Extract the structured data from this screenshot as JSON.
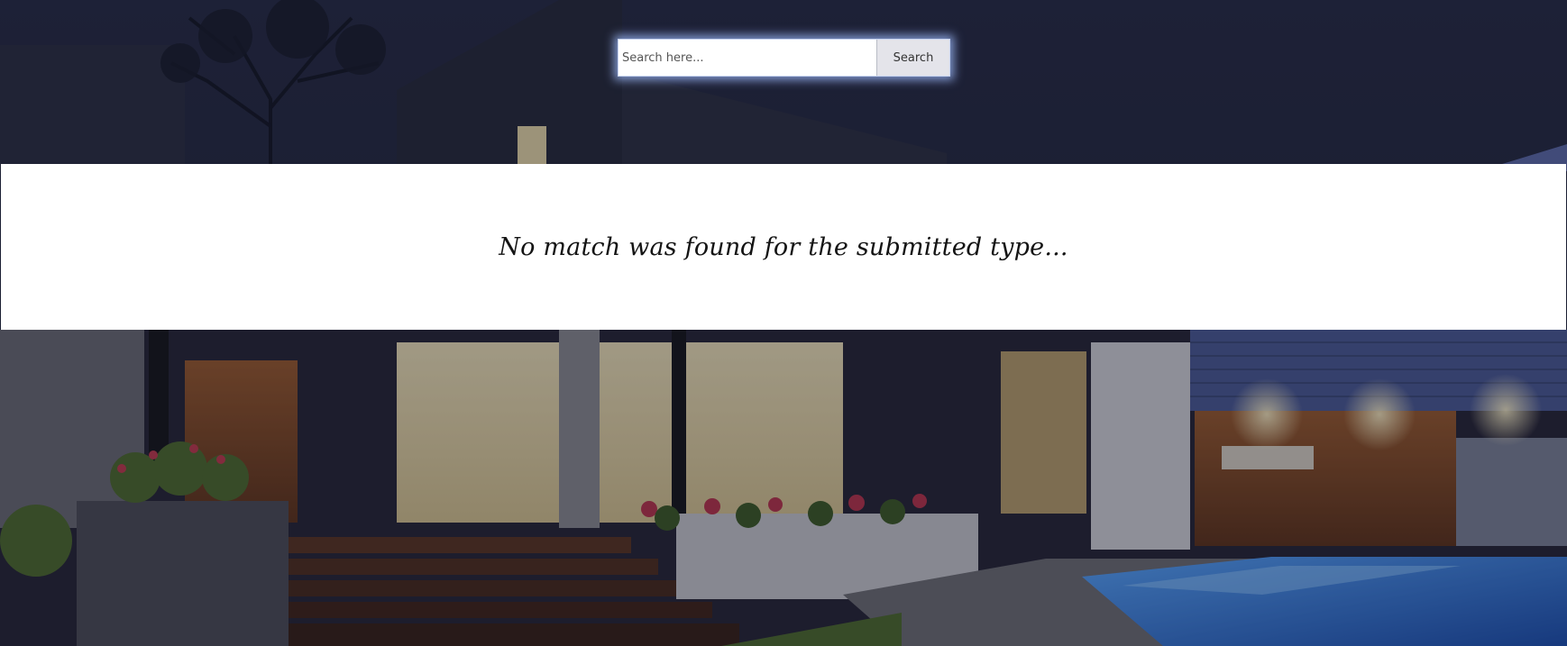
{
  "search": {
    "placeholder": "Search here...",
    "value": "",
    "button_label": "Search"
  },
  "results": {
    "message": "No match was found for the submitted type..."
  },
  "background": {
    "subject": "modern house with pool at night",
    "colors": {
      "sky": "#22253b",
      "wood": "#8a4a22",
      "pool": "#2f7bd8",
      "warm_light": "#f3e2b0"
    }
  }
}
